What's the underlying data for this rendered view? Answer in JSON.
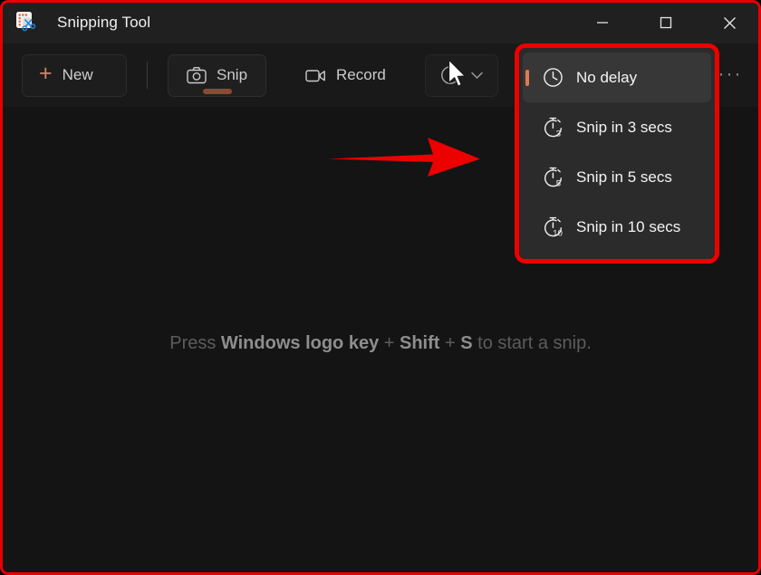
{
  "window": {
    "title": "Snipping Tool",
    "app_icon": "snipping-tool-icon",
    "controls": {
      "minimize": "minimize-icon",
      "maximize": "maximize-icon",
      "close": "close-icon"
    }
  },
  "toolbar": {
    "new_label": "New",
    "new_icon": "plus-icon",
    "tabs": [
      {
        "label": "Snip",
        "icon": "camera-icon",
        "active": true
      },
      {
        "label": "Record",
        "icon": "video-camera-icon",
        "active": false
      }
    ],
    "delay_button": {
      "icon": "clock-icon",
      "chevron": "chevron-down-icon"
    },
    "more_label": "···"
  },
  "content": {
    "hint_prefix": "Press ",
    "hint_bold_1": "Windows logo key",
    "hint_mid_1": " + ",
    "hint_bold_2": "Shift",
    "hint_mid_2": " + ",
    "hint_bold_3": "S",
    "hint_suffix": " to start a snip."
  },
  "delay_menu": {
    "items": [
      {
        "label": "No delay",
        "icon": "clock-icon",
        "selected": true
      },
      {
        "label": "Snip in 3 secs",
        "icon": "stopwatch-3-icon",
        "selected": false
      },
      {
        "label": "Snip in 5 secs",
        "icon": "stopwatch-5-icon",
        "selected": false
      },
      {
        "label": "Snip in 10 secs",
        "icon": "stopwatch-10-icon",
        "selected": false
      }
    ],
    "timer_digits": [
      "",
      "3",
      "5",
      "10"
    ]
  },
  "annotations": {
    "arrow": "red-arrow-pointing-right",
    "arrow_color": "#ed0000",
    "dropdown_highlight_color": "#ed0000",
    "window_highlight_color": "#e80000"
  },
  "colors": {
    "accent": "#e07a52",
    "tab_underline": "#8a4a33",
    "window_bg": "#191919",
    "content_bg": "#141414",
    "titlebar_bg": "#202020",
    "menu_bg": "#2b2b2b"
  },
  "cursor": {
    "name": "mouse-pointer"
  }
}
